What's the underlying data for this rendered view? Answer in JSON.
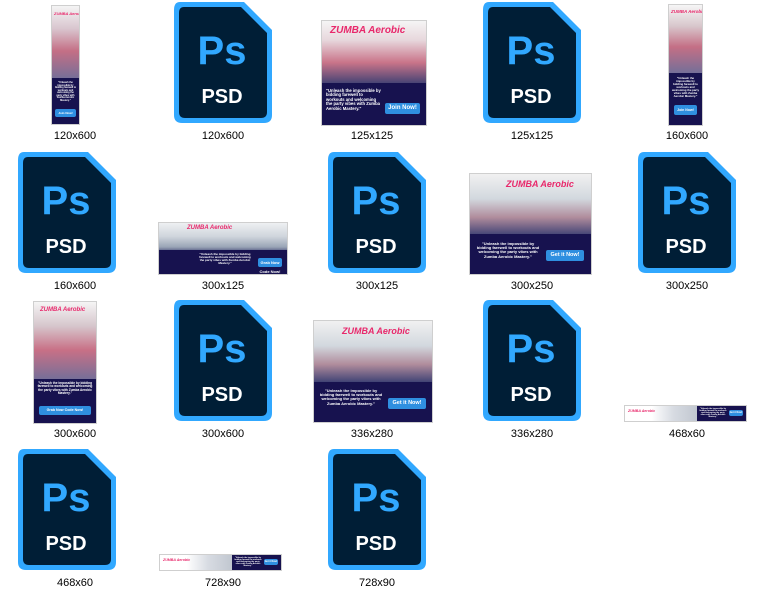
{
  "icon_text": {
    "ps": "Ps",
    "psd": "PSD"
  },
  "colors": {
    "psd_bg": "#001e36",
    "psd_accent": "#31a8ff",
    "banner_pink": "#e8286b",
    "banner_navy": "#17124f",
    "cta_blue": "#2f8fe0"
  },
  "banner_text": {
    "logo": "ZUMBA Aerobic",
    "copy": "\"Unleash the impossible by bidding farewell to workouts and welcoming the party vibes with Zumba Aerobic Mastery.\"",
    "cta_join": "Join Now!",
    "cta_get": "Get it Now!",
    "cta_grab": "Grab Now Code Now!"
  },
  "files": [
    {
      "label": "120x600",
      "kind": "image"
    },
    {
      "label": "120x600",
      "kind": "psd"
    },
    {
      "label": "125x125",
      "kind": "image"
    },
    {
      "label": "125x125",
      "kind": "psd"
    },
    {
      "label": "160x600",
      "kind": "image"
    },
    {
      "label": "160x600",
      "kind": "psd"
    },
    {
      "label": "300x125",
      "kind": "image"
    },
    {
      "label": "300x125",
      "kind": "psd"
    },
    {
      "label": "300x250",
      "kind": "image"
    },
    {
      "label": "300x250",
      "kind": "psd"
    },
    {
      "label": "300x600",
      "kind": "image"
    },
    {
      "label": "300x600",
      "kind": "psd"
    },
    {
      "label": "336x280",
      "kind": "image"
    },
    {
      "label": "336x280",
      "kind": "psd"
    },
    {
      "label": "468x60",
      "kind": "image"
    },
    {
      "label": "468x60",
      "kind": "psd"
    },
    {
      "label": "728x90",
      "kind": "image"
    },
    {
      "label": "728x90",
      "kind": "psd"
    }
  ]
}
